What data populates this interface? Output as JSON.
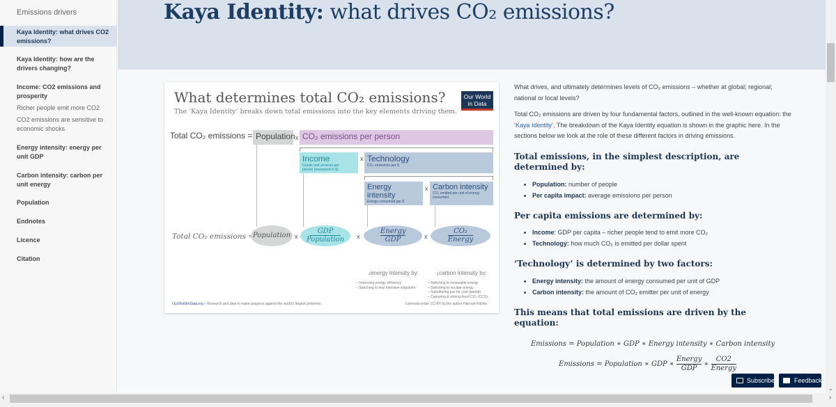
{
  "sidebar": {
    "title": "Emissions drivers",
    "items": [
      {
        "label": "Kaya Identity: what drives CO2 emissions?",
        "active": true
      },
      {
        "label": "Kaya Identity: how are the drivers changing?"
      },
      {
        "label": "Income: CO2 emissions and prosperity"
      },
      {
        "label": "Richer people emit more CO2",
        "sub": true
      },
      {
        "label": "CO2 emissions are sensitive to economic shocks",
        "sub": true
      },
      {
        "label": "Energy intensity: energy per unit GDP"
      },
      {
        "label": "Carbon intensity: carbon per unit energy"
      },
      {
        "label": "Population"
      },
      {
        "label": "Endnotes"
      },
      {
        "label": "Licence"
      },
      {
        "label": "Citation"
      }
    ]
  },
  "header": {
    "title_bold": "Kaya Identity:",
    "title_rest": " what drives CO₂ emissions?"
  },
  "graphic": {
    "title": "What determines total CO₂ emissions?",
    "subtitle": "The ‘Kaya Identity’ breaks down total emissions into the key elements driving them.",
    "logo": "Our World in Data",
    "total_label": "Total CO₂ emissions =",
    "population": "Population",
    "per_person": "CO₂ emissions per person",
    "income": "Income",
    "income_sub": "Goods and services per person (measured in $)",
    "technology": "Technology",
    "technology_sub": "CO₂ emissions per $",
    "energy_intensity": "Energy intensity",
    "energy_intensity_sub": "Energy consumed per $",
    "carbon_intensity": "Carbon intensity",
    "carbon_intensity_sub": "CO₂ emitted per unit of energy consumed.",
    "times": "x",
    "eq_label": "Total CO₂ emissions =",
    "e_population": "Population",
    "e_gdp_num": "GDP",
    "e_gdp_den": "Population",
    "e_energy_num": "Energy",
    "e_energy_den": "GDP",
    "e_co2_num": "CO₂",
    "e_co2_den": "Energy",
    "energy_reduce": "energy intensity by:",
    "energy_notes": [
      "– Improving energy efficiency",
      "– Switching to less intensive industries"
    ],
    "carbon_reduce": "carbon intensity by:",
    "carbon_notes": [
      "– Switching to renewable energy",
      "– Switching to nuclear energy",
      "– Substituting gas for coal (partial)",
      "– Capturing & storing fossil CO₂ (CCS)"
    ],
    "footer_site": "OurWorldInData.org",
    "footer_text": " – Research and data to make progress against the world’s largest problems.",
    "license": "Licensed under CC-BY by the author Hannah Ritchie."
  },
  "content": {
    "p1": "What drives, and ultimately determines levels of CO₂ emissions – whether at global; regional; national or local levels?",
    "p2a": "Total CO₂ emissions are driven by four fundamental factors, outlined in the well-known equation: the ‘",
    "p2link": "Kaya Identity",
    "p2b": "’. The breakdown of the Kaya Identity equation is shown in the graphic here. In the sections below we look at the role of these different factors in driving emissions.",
    "h1": "Total emissions, in the simplest description, are determined by:",
    "l1": [
      {
        "b": "Population:",
        "t": " number of people"
      },
      {
        "b": "Per capita impact:",
        "t": " average emissions per person"
      }
    ],
    "h2": "Per capita emissions are determined by:",
    "l2": [
      {
        "b": "Income",
        "t": ": GDP per capita – richer people tend to emit more CO₂"
      },
      {
        "b": "Technology:",
        "t": " how much CO₂ is emitted per dollar spent"
      }
    ],
    "h3": "‘Technology’ is determined by two factors:",
    "l3": [
      {
        "b": "Energy intensity:",
        "t": " the amount of energy consumed per unit of GDP"
      },
      {
        "b": "Carbon intensity:",
        "t": " the amount of CO₂ emitter per unit of energy"
      }
    ],
    "h4": "This means that total emissions are driven by the equation:",
    "eq1": "Emissions = Population ∗ GDP ∗ Energy intensity ∗ Carbon intensity",
    "eq2": "Emissions = Population ∗ GDP ∗",
    "eq2_f1n": "Energy",
    "eq2_f1d": "GDP",
    "eq2_star": "∗",
    "eq2_f2n": "CO2",
    "eq2_f2d": "Energy"
  },
  "buttons": {
    "subscribe": "Subscribe",
    "feedback": "Feedback"
  },
  "colors": {
    "navy": "#002147",
    "header_bg": "#d9e2ec",
    "purple": "#ddc7e3",
    "teal": "#a8e3e8",
    "blue": "#b9c9dc",
    "grey": "#d5d6d6"
  }
}
